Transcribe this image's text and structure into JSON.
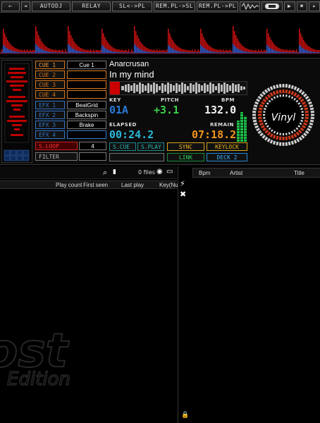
{
  "toolbar": {
    "autodj": "AUTODJ",
    "relay": "RELAY",
    "sl_pl": "SL<->PL",
    "rem_pl_sl": "REM.PL->SL",
    "rem_pl_pl": "REM.PL->PL"
  },
  "deck": {
    "cues": [
      {
        "label": "CUE 1",
        "value": "Cue 1"
      },
      {
        "label": "CUE 2",
        "value": ""
      },
      {
        "label": "CUE 3",
        "value": ""
      },
      {
        "label": "CUE 4",
        "value": ""
      }
    ],
    "effects": [
      {
        "label": "EFX 1",
        "value": "BeatGrid"
      },
      {
        "label": "EFX 2",
        "value": "Backspin"
      },
      {
        "label": "EFX 3",
        "value": "Brake"
      },
      {
        "label": "EFX 4",
        "value": ""
      }
    ],
    "sloop_label": "S.LOOP",
    "sloop_value": "4",
    "filter_label": "FILTER",
    "artist": "Anarcrusan",
    "title": "In my mind",
    "key_label": "KEY",
    "key_value": "01A",
    "pitch_label": "PITCH",
    "pitch_value": "+3.1",
    "bpm_label": "BPM",
    "bpm_value": "132.0",
    "elapsed_label": "ELAPSED",
    "elapsed_value": "00:24.2",
    "remain_label": "REMAIN",
    "remain_value": "07:18.2",
    "scue_label": "S.CUE",
    "splay_label": "S.PLAY",
    "sync_label": "SYNC",
    "keylock_label": "KEYLOCK",
    "link_label": "LINK",
    "deck_label": "DECK 2",
    "vinyl_label": "Vinyl"
  },
  "browser": {
    "files_count": "0 files",
    "columns": [
      "Play count",
      "First seen",
      "Last play",
      "Key(Nu"
    ]
  },
  "sidelist": {
    "columns": [
      "Bpm",
      "Artist",
      "Title"
    ]
  },
  "watermark": {
    "line1": "ost",
    "line2": "Edition"
  }
}
